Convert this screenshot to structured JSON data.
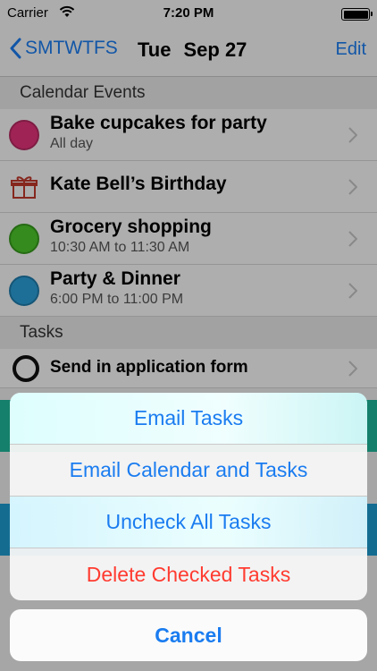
{
  "status_bar": {
    "carrier": "Carrier",
    "time": "7:20 PM"
  },
  "nav": {
    "back_label": "SMTWTFS",
    "weekday": "Tue",
    "date": "Sep 27",
    "edit_label": "Edit"
  },
  "sections": {
    "events_header": "Calendar Events",
    "tasks_header": "Tasks"
  },
  "events": [
    {
      "title": "Bake cupcakes for party",
      "subtitle": "All day",
      "color": "#e5337a",
      "icon": "pink-circle-icon"
    },
    {
      "title": "Kate Bell’s Birthday",
      "subtitle": "",
      "color": "#c0392b",
      "icon": "gift-icon"
    },
    {
      "title": "Grocery shopping",
      "subtitle": "10:30 AM to 11:30 AM",
      "color": "#4cc72a",
      "icon": "green-circle-icon"
    },
    {
      "title": "Party & Dinner",
      "subtitle": "6:00 PM to 11:00 PM",
      "color": "#2b9fd9",
      "icon": "blue-circle-icon"
    }
  ],
  "tasks": [
    {
      "title": "Send in application form",
      "icon": "unchecked-circle-icon"
    }
  ],
  "action_sheet": {
    "email_tasks": "Email Tasks",
    "email_calendar": "Email Calendar and Tasks",
    "uncheck_all": "Uncheck All Tasks",
    "delete_checked": "Delete Checked Tasks",
    "cancel": "Cancel"
  },
  "colors": {
    "accent": "#1a7cf0",
    "destructive": "#ff3b30"
  }
}
